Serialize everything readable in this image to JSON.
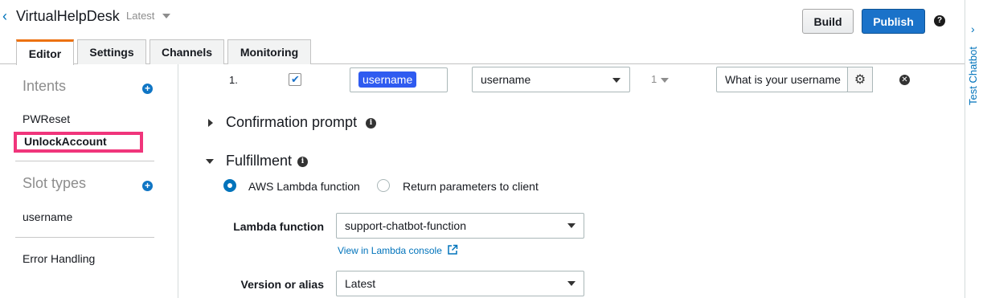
{
  "header": {
    "title": "VirtualHelpDesk",
    "version": "Latest",
    "build_label": "Build",
    "publish_label": "Publish",
    "help_glyph": "?"
  },
  "tabs": [
    {
      "label": "Editor",
      "active": true
    },
    {
      "label": "Settings",
      "active": false
    },
    {
      "label": "Channels",
      "active": false
    },
    {
      "label": "Monitoring",
      "active": false
    }
  ],
  "sidebar": {
    "intents_heading": "Intents",
    "intents": [
      "PWReset",
      "UnlockAccount"
    ],
    "selected_intent": "UnlockAccount",
    "slot_types_heading": "Slot types",
    "slot_types": [
      "username"
    ],
    "error_handling": "Error Handling"
  },
  "slot_row": {
    "index": "1.",
    "required": true,
    "name": "username",
    "type": "username",
    "version": "1",
    "prompt": "What is your username"
  },
  "confirmation": {
    "heading": "Confirmation prompt",
    "expanded": false
  },
  "fulfillment": {
    "heading": "Fulfillment",
    "expanded": true,
    "options": [
      {
        "label": "AWS Lambda function",
        "selected": true
      },
      {
        "label": "Return parameters to client",
        "selected": false
      }
    ],
    "lambda_label": "Lambda function",
    "lambda_value": "support-chatbot-function",
    "lambda_console_link": "View in Lambda console",
    "version_label": "Version or alias",
    "version_value": "Latest"
  },
  "right_panel": {
    "label": "Test Chatbot"
  },
  "colors": {
    "accent": "#0073bb",
    "publish": "#1a72c9",
    "active_tab": "#ec7211",
    "highlight": "#f0357b",
    "slot_chip": "#2f5bf0"
  },
  "icons": {
    "back": "chevron-left-icon",
    "help": "help-icon",
    "add": "plus-circle-icon",
    "settings": "gear-icon",
    "remove": "close-circle-icon",
    "info": "info-icon",
    "external": "external-link-icon"
  }
}
